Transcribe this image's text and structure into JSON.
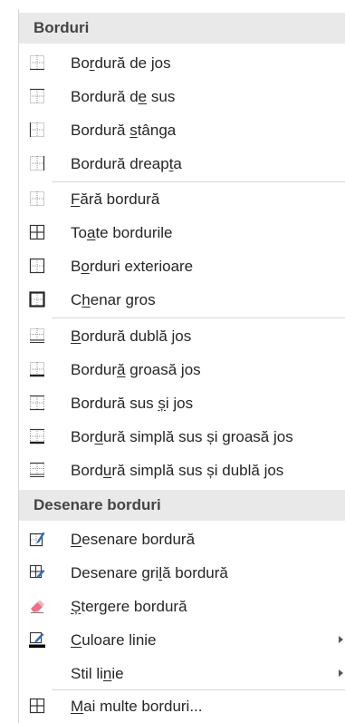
{
  "sections": [
    {
      "title": "Borduri"
    },
    {
      "title": "Desenare borduri"
    }
  ],
  "items": [
    {
      "pre": "Bo",
      "acc": "r",
      "post": "dură de jos",
      "icon": "border-bottom-icon"
    },
    {
      "pre": "Bordură d",
      "acc": "e",
      "post": " sus",
      "icon": "border-top-icon"
    },
    {
      "pre": "Bordură ",
      "acc": "s",
      "post": "tânga",
      "icon": "border-left-icon"
    },
    {
      "pre": "Bordură dreap",
      "acc": "t",
      "post": "a",
      "icon": "border-right-icon"
    },
    {
      "pre": "",
      "acc": "F",
      "post": "ără bordură",
      "icon": "no-border-icon"
    },
    {
      "pre": "To",
      "acc": "a",
      "post": "te bordurile",
      "icon": "all-borders-icon"
    },
    {
      "pre": "B",
      "acc": "o",
      "post": "rduri exterioare",
      "icon": "outside-borders-icon"
    },
    {
      "pre": "C",
      "acc": "h",
      "post": "enar gros",
      "icon": "thick-box-border-icon"
    },
    {
      "pre": "",
      "acc": "B",
      "post": "ordură dublă jos",
      "icon": "bottom-double-border-icon"
    },
    {
      "pre": "Bordur",
      "acc": "ă",
      "post": " groasă jos",
      "icon": "thick-bottom-border-icon"
    },
    {
      "pre": "Bordură sus ",
      "acc": "ș",
      "post": "i jos",
      "icon": "top-bottom-border-icon"
    },
    {
      "pre": "Bor",
      "acc": "d",
      "post": "ură simplă sus și groasă jos",
      "icon": "top-thick-bottom-border-icon"
    },
    {
      "pre": "Bord",
      "acc": "u",
      "post": "ră simplă sus și dublă jos",
      "icon": "top-double-bottom-border-icon"
    },
    {
      "pre": "",
      "acc": "D",
      "post": "esenare bordură",
      "icon": "draw-border-icon"
    },
    {
      "pre": "Desenare gri",
      "acc": "l",
      "post": "ă bordură",
      "icon": "draw-border-grid-icon"
    },
    {
      "pre": "",
      "acc": "Ș",
      "post": "tergere bordură",
      "icon": "erase-border-icon"
    },
    {
      "pre": "",
      "acc": "C",
      "post": "uloare linie",
      "icon": "line-color-icon"
    },
    {
      "pre": "Stil li",
      "acc": "n",
      "post": "ie",
      "icon": "line-style-icon"
    },
    {
      "pre": "",
      "acc": "M",
      "post": "ai multe borduri...",
      "icon": "more-borders-icon"
    }
  ],
  "colors": {
    "header_bg": "#e9e9e9",
    "line_color_swatch": "#000000",
    "eraser": "#e8738a",
    "pen_blue": "#2f6db5"
  }
}
